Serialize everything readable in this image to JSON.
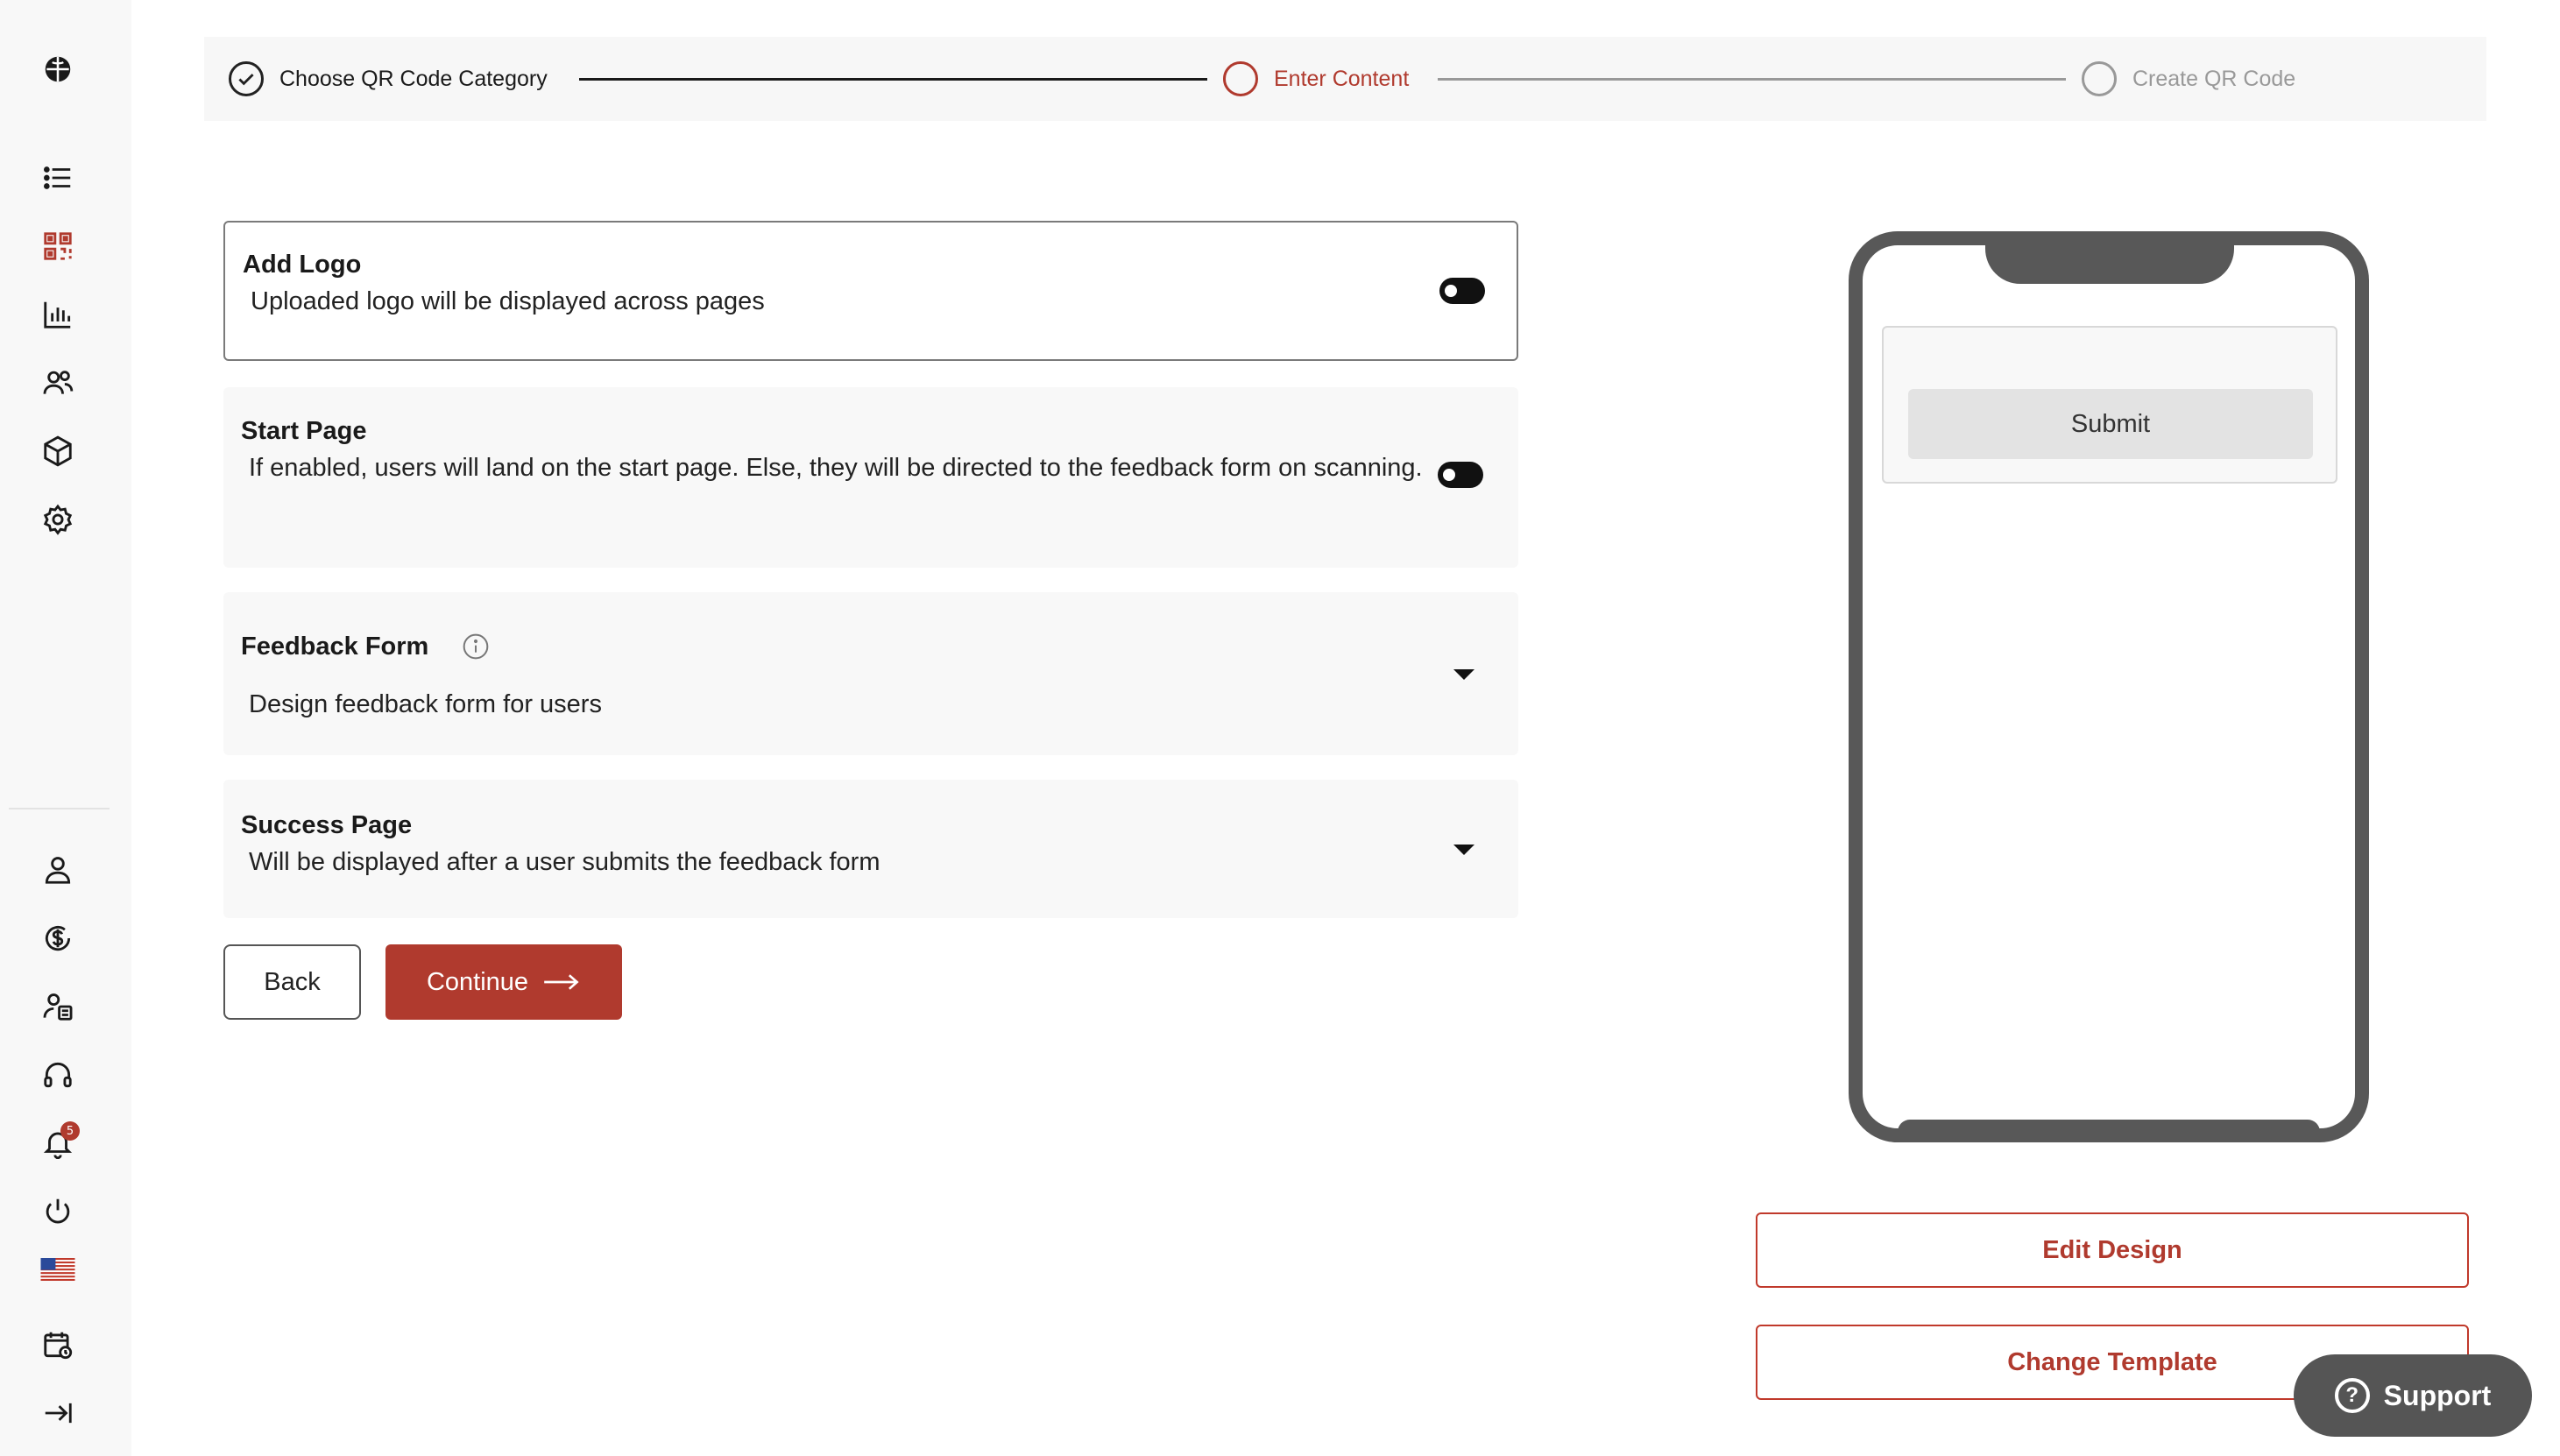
{
  "colors": {
    "accent": "#b03a2e",
    "inactive": "#999999",
    "active_text": "#1a1a1a"
  },
  "sidebar": {
    "top_icons": [
      "globe-icon",
      "list-icon",
      "qr-code-icon",
      "bar-chart-icon",
      "users-icon",
      "cube-icon",
      "gear-icon"
    ],
    "bottom_icons": [
      "user-icon",
      "dollar-icon",
      "user-card-icon",
      "headset-icon",
      "bell-icon",
      "power-icon",
      "us-flag-icon",
      "calendar-icon",
      "collapse-icon"
    ],
    "notification_count": "5"
  },
  "stepper": {
    "steps": [
      {
        "label": "Choose QR Code Category",
        "state": "done"
      },
      {
        "label": "Enter Content",
        "state": "current"
      },
      {
        "label": "Create QR Code",
        "state": "pending"
      }
    ]
  },
  "cards": {
    "add_logo": {
      "title": "Add Logo",
      "desc": "Uploaded logo will be displayed across pages"
    },
    "start_page": {
      "title": "Start Page",
      "desc": "If enabled, users will land on the start page. Else, they will be directed to the feedback form on scanning."
    },
    "feedback_form": {
      "title": "Feedback Form",
      "desc": "Design feedback form for users"
    },
    "success_page": {
      "title": "Success Page",
      "desc": "Will be displayed after a user submits the feedback form"
    }
  },
  "actions": {
    "back_label": "Back",
    "continue_label": "Continue"
  },
  "preview": {
    "submit_label": "Submit",
    "edit_design_label": "Edit Design",
    "change_template_label": "Change Template"
  },
  "support": {
    "label": "Support"
  }
}
